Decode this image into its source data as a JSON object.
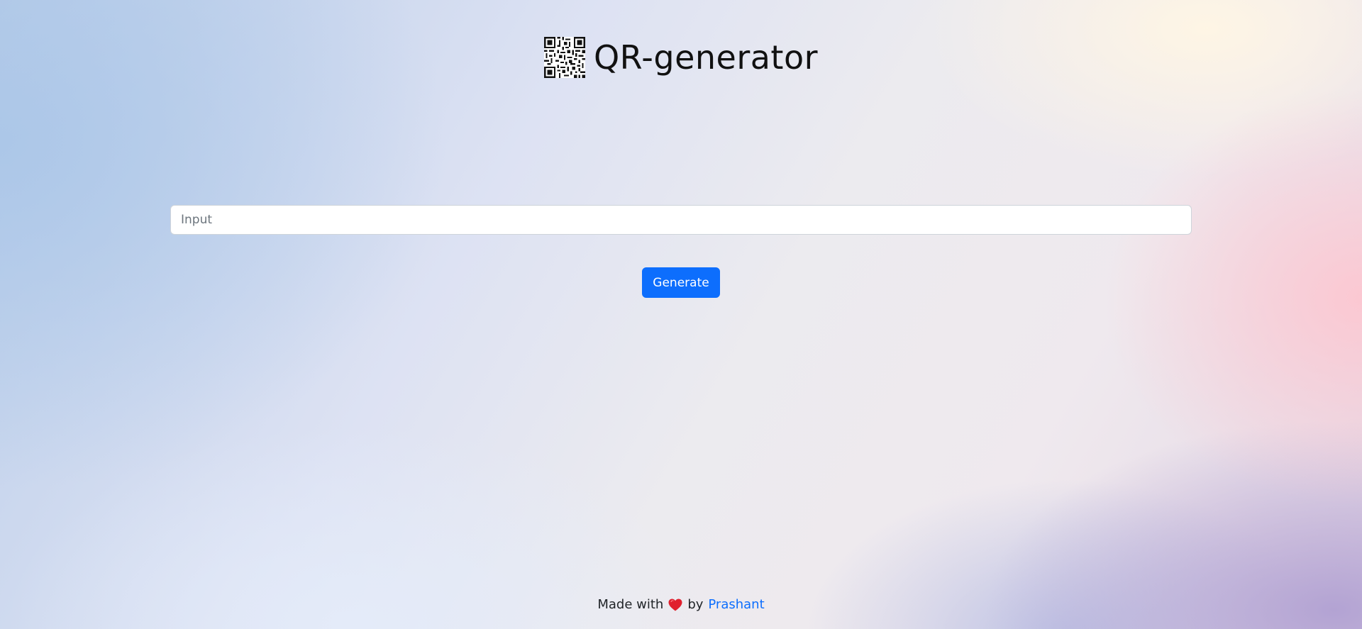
{
  "header": {
    "icon": "qr-code-icon",
    "title": "QR-generator"
  },
  "form": {
    "input_value": "",
    "input_placeholder": "Input",
    "generate_label": "Generate"
  },
  "footer": {
    "made_with": "Made with",
    "heart_icon": "heart-icon",
    "by": "by",
    "author": "Prashant"
  },
  "colors": {
    "primary": "#0d6efd",
    "heart": "#e0202e",
    "title": "#111111"
  }
}
